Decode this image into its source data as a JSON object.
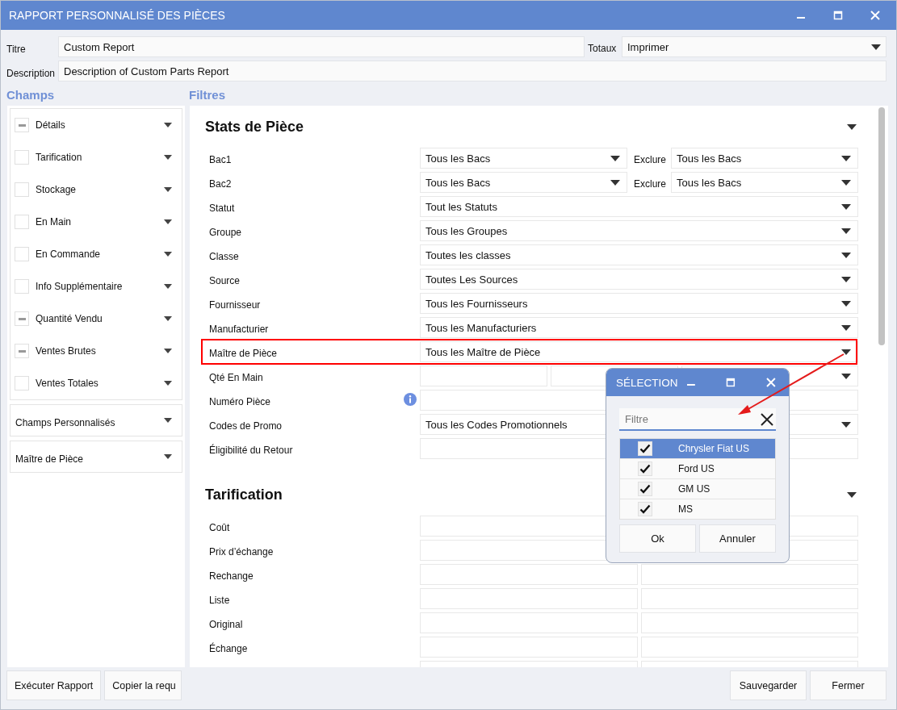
{
  "window": {
    "title": "RAPPORT PERSONNALISÉ DES PIÈCES"
  },
  "header": {
    "title_label": "Titre",
    "title_value": "Custom Report",
    "totals_label": "Totaux",
    "totals_value": "Imprimer",
    "description_label": "Description",
    "description_value": "Description of Custom Parts Report"
  },
  "fields_heading": "Champs",
  "filters_heading": "Filtres",
  "field_groups": [
    {
      "label": "Détails",
      "partial": true
    },
    {
      "label": "Tarification",
      "partial": false
    },
    {
      "label": "Stockage",
      "partial": false
    },
    {
      "label": "En Main",
      "partial": false
    },
    {
      "label": "En Commande",
      "partial": false
    },
    {
      "label": "Info Supplémentaire",
      "partial": false
    },
    {
      "label": "Quantité Vendu",
      "partial": true
    },
    {
      "label": "Ventes Brutes",
      "partial": true
    },
    {
      "label": "Ventes Totales",
      "partial": false
    }
  ],
  "field_sections": [
    "Champs Personnalisés",
    "Maître de Pièce"
  ],
  "filter_sections": [
    {
      "title": "Stats de Pièce",
      "rows": [
        {
          "label": "Bac1",
          "kind": "select-exclude",
          "value": "Tous les Bacs",
          "exclude_label": "Exclure",
          "exclude_value": "Tous les Bacs"
        },
        {
          "label": "Bac2",
          "kind": "select-exclude",
          "value": "Tous les Bacs",
          "exclude_label": "Exclure",
          "exclude_value": "Tous les Bacs"
        },
        {
          "label": "Statut",
          "kind": "select",
          "value": "Tout les Statuts"
        },
        {
          "label": "Groupe",
          "kind": "select",
          "value": "Tous les Groupes"
        },
        {
          "label": "Classe",
          "kind": "select",
          "value": "Toutes les classes"
        },
        {
          "label": "Source",
          "kind": "select",
          "value": "Toutes Les Sources"
        },
        {
          "label": "Fournisseur",
          "kind": "select",
          "value": "Tous les Fournisseurs"
        },
        {
          "label": "Manufacturier",
          "kind": "select",
          "value": "Tous les Manufacturiers"
        },
        {
          "label": "Maître de Pièce",
          "kind": "select",
          "value": "Tous les Maître de Pièce",
          "highlighted": true
        },
        {
          "label": "Qté En Main",
          "kind": "range"
        },
        {
          "label": "Numéro Pièce",
          "kind": "input",
          "info": true
        },
        {
          "label": "Codes de Promo",
          "kind": "select",
          "value": "Tous les Codes Promotionnels"
        },
        {
          "label": "Éligibilité du Retour",
          "kind": "input"
        }
      ]
    },
    {
      "title": "Tarification",
      "rows": [
        {
          "label": "Coût",
          "kind": "input"
        },
        {
          "label": "Prix d’échange",
          "kind": "input"
        },
        {
          "label": "Rechange",
          "kind": "pair"
        },
        {
          "label": "Liste",
          "kind": "pair"
        },
        {
          "label": "Original",
          "kind": "pair"
        },
        {
          "label": "Échange",
          "kind": "pair"
        },
        {
          "kind": "pair"
        }
      ]
    }
  ],
  "footer": {
    "left_buttons": [
      "Exécuter Rapport",
      "Copier la requ"
    ],
    "right_buttons": [
      "Sauvegarder",
      "Fermer"
    ]
  },
  "popup": {
    "title": "SÉLECTION",
    "filter_placeholder": "Filtre",
    "pointer_arrow": true,
    "items": [
      {
        "label": "Chrysler Fiat US",
        "checked": true,
        "selected": true
      },
      {
        "label": "Ford US",
        "checked": true,
        "selected": false
      },
      {
        "label": "GM US",
        "checked": true,
        "selected": false
      },
      {
        "label": "MS",
        "checked": true,
        "selected": false
      }
    ],
    "buttons": [
      "Ok",
      "Annuler"
    ]
  }
}
